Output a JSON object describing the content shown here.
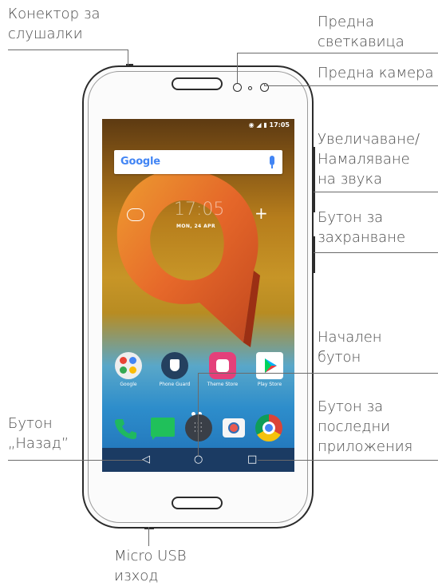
{
  "labels": {
    "headphone": [
      "Конектор за",
      "слушалки"
    ],
    "flash": [
      "Предна",
      "светкавица"
    ],
    "front_camera": "Предна камера",
    "volume": [
      "Увеличаване/",
      "Намаляване",
      "на звука"
    ],
    "power": [
      "Бутон за",
      "захранване"
    ],
    "home": [
      "Начален",
      "бутон"
    ],
    "back": [
      "Бутон",
      "„Назад”"
    ],
    "recent": [
      "Бутон за",
      "последни",
      "приложения"
    ],
    "usb": [
      "Micro USB",
      "изход"
    ]
  },
  "screen": {
    "status_time": "17:05",
    "search_brand": "Google",
    "clock": "17:05",
    "date": "MON, 24 APR",
    "apps": [
      {
        "label": "Google",
        "icon": "google-folder-icon"
      },
      {
        "label": "Phone Guard",
        "icon": "phone-guard-icon"
      },
      {
        "label": "Theme Store",
        "icon": "theme-store-icon"
      },
      {
        "label": "Play Store",
        "icon": "play-store-icon"
      }
    ],
    "dock": [
      "phone-icon",
      "messages-icon",
      "app-drawer-icon",
      "camera-icon",
      "chrome-icon"
    ],
    "nav": [
      "back-icon",
      "home-icon",
      "recent-apps-icon"
    ]
  },
  "colors": {
    "phone_frame": "#2b2b2b",
    "navbar": "#1b3b63",
    "label_text": "#4a4a4a"
  }
}
